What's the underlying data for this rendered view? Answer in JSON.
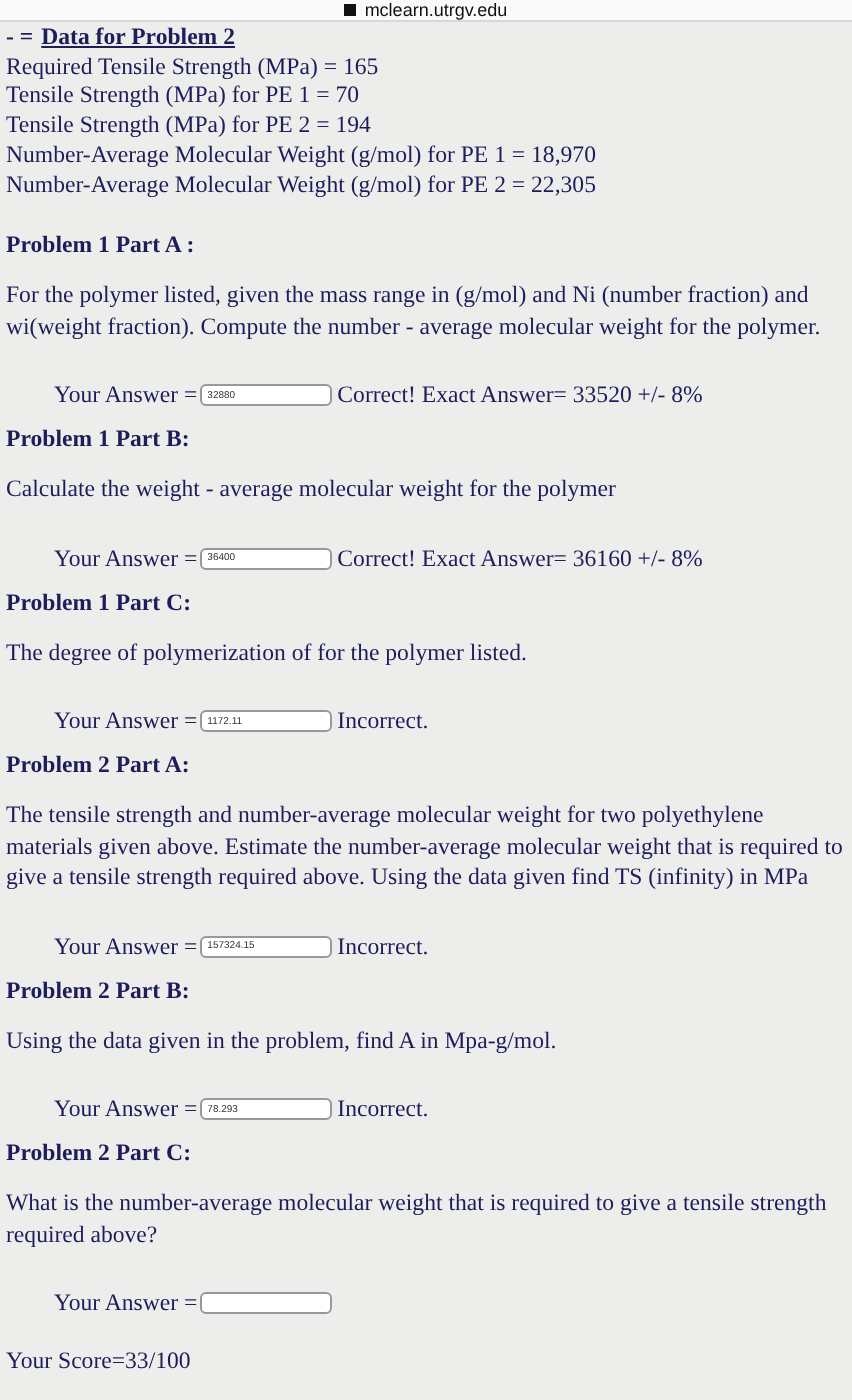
{
  "url_bar": {
    "url": "mclearn.utrgv.edu"
  },
  "data_heading": {
    "prefix": "- =",
    "title": "Data for Problem 2"
  },
  "data_lines": [
    "Required Tensile Strength (MPa) = 165",
    "Tensile Strength (MPa) for PE 1 = 70",
    "Tensile Strength (MPa) for PE 2 = 194",
    "Number-Average Molecular Weight (g/mol) for PE 1 = 18,970",
    "Number-Average Molecular Weight (g/mol) for PE 2 = 22,305"
  ],
  "items": [
    {
      "kind": "heading",
      "text": "Problem 1 Part A :"
    },
    {
      "kind": "paragraph",
      "text": "For the polymer listed, given the mass range in (g/mol) and Ni (number fraction) and wi(weight fraction). Compute the number - average molecular weight for the polymer."
    },
    {
      "kind": "answer",
      "label": "Your Answer =",
      "value": "32880",
      "result": "Correct! Exact Answer= 33520 +/- 8%"
    },
    {
      "kind": "heading",
      "text": "Problem 1 Part B:"
    },
    {
      "kind": "paragraph",
      "text": "Calculate the weight - average molecular weight for the polymer"
    },
    {
      "kind": "answer",
      "label": "Your Answer =",
      "value": "36400",
      "result": "Correct! Exact Answer= 36160 +/- 8%"
    },
    {
      "kind": "heading",
      "text": "Problem 1 Part C:"
    },
    {
      "kind": "paragraph",
      "text": "The degree of polymerization of for the polymer listed."
    },
    {
      "kind": "answer",
      "label": "Your Answer =",
      "value": "1172.11",
      "result": "Incorrect."
    },
    {
      "kind": "heading",
      "text": "Problem 2 Part A:"
    },
    {
      "kind": "paragraph",
      "text": "The tensile strength and number-average molecular weight for two polyethylene materials given above. Estimate the number-average molecular weight that is required to give a tensile strength required above. Using the data given find TS (infinity) in MPa"
    },
    {
      "kind": "answer",
      "label": "Your Answer =",
      "value": "157324.15",
      "result": "Incorrect."
    },
    {
      "kind": "heading",
      "text": "Problem 2 Part B:"
    },
    {
      "kind": "paragraph",
      "text": "Using the data given in the problem, find A in Mpa-g/mol."
    },
    {
      "kind": "answer",
      "label": "Your Answer =",
      "value": "78.293",
      "result": "Incorrect."
    },
    {
      "kind": "heading",
      "text": "Problem 2 Part C:"
    },
    {
      "kind": "paragraph",
      "text": "What is the number-average molecular weight that is required to give a tensile strength required above?"
    },
    {
      "kind": "answer",
      "label": "Your Answer =",
      "value": ""
    }
  ],
  "score": "Your Score=33/100"
}
